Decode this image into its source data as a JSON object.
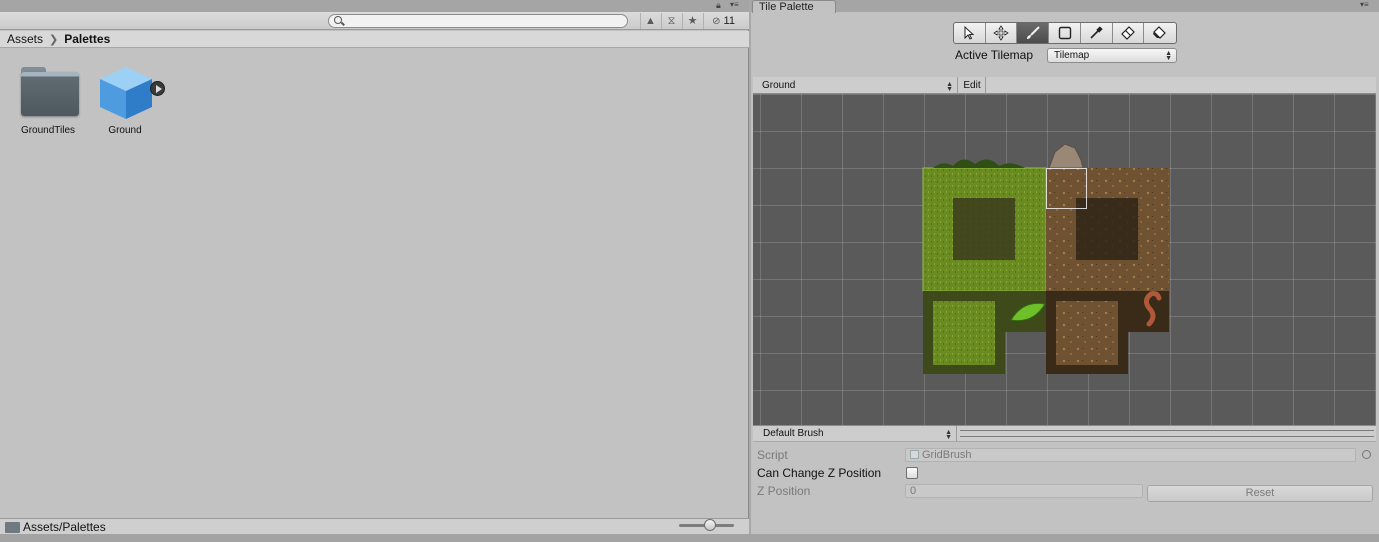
{
  "project_panel": {
    "search": {
      "placeholder": ""
    },
    "toolbar": {
      "hidden_count": "11"
    },
    "breadcrumb": {
      "root": "Assets",
      "current": "Palettes"
    },
    "assets": [
      {
        "name": "GroundTiles",
        "icon": "folder-icon"
      },
      {
        "name": "Ground",
        "icon": "prefab-cube-icon"
      }
    ],
    "status_path": "Assets/Palettes"
  },
  "tile_palette": {
    "tab_label": "Tile Palette",
    "tools": [
      "select-tool-icon",
      "move-tool-icon",
      "paint-brush-icon",
      "box-fill-icon",
      "picker-icon",
      "eraser-icon",
      "flood-fill-icon"
    ],
    "active_tool": "paint-brush-icon",
    "active_tilemap_label": "Active Tilemap",
    "active_tilemap_value": "Tilemap",
    "palette_name": "Ground",
    "edit_label": "Edit",
    "brush": {
      "name": "Default Brush",
      "script_label": "Script",
      "script_value": "GridBrush",
      "can_change_z_label": "Can Change Z Position",
      "can_change_z_checked": false,
      "z_position_label": "Z Position",
      "z_position_value": "0",
      "reset_label": "Reset"
    }
  }
}
